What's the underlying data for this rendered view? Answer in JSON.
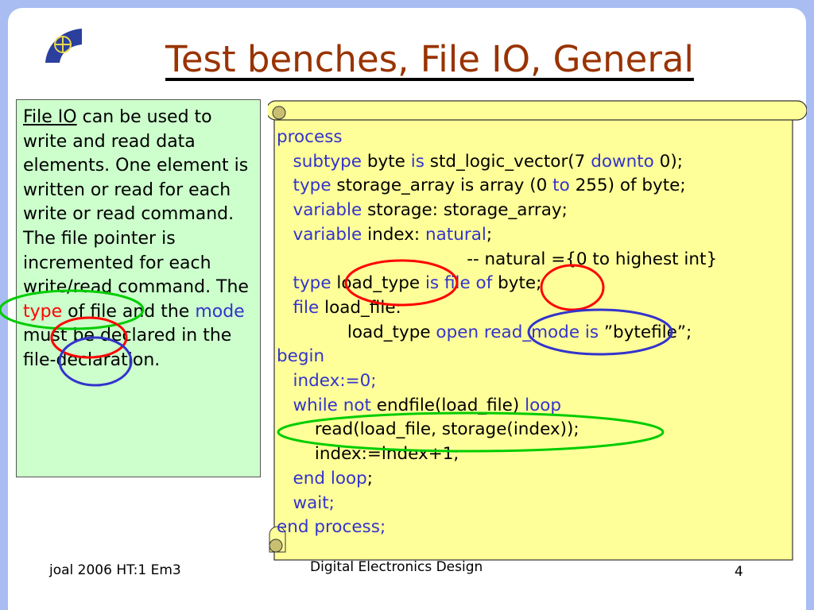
{
  "title": "Test benches, File IO, General",
  "note": {
    "link": "File IO",
    "p1": " can be used to write and read data elements. One element is written or read for each write or read command. The file pointer is incremented for each write/read command. The ",
    "type": "type",
    "p2": " of file and the ",
    "mode": "mode",
    "p3": " must be declared in the file-declaration."
  },
  "code": [
    [
      [
        "k",
        "process"
      ]
    ],
    [
      [
        "n",
        "   "
      ],
      [
        "k",
        "subtype"
      ],
      [
        "n",
        " byte "
      ],
      [
        "k",
        "is"
      ],
      [
        "n",
        " std_logic_vector(7 "
      ],
      [
        "k",
        "downto"
      ],
      [
        "n",
        " 0);"
      ]
    ],
    [
      [
        "n",
        "   "
      ],
      [
        "k",
        "type"
      ],
      [
        "n",
        " storage_array is array (0 "
      ],
      [
        "k",
        "to"
      ],
      [
        "n",
        " 255) of byte;"
      ]
    ],
    [
      [
        "n",
        "   "
      ],
      [
        "k",
        "variable"
      ],
      [
        "n",
        " storage: storage_array;"
      ]
    ],
    [
      [
        "n",
        "   "
      ],
      [
        "k",
        "variable"
      ],
      [
        "n",
        " index: "
      ],
      [
        "k",
        "natural"
      ],
      [
        "n",
        ";"
      ]
    ],
    [
      [
        "n",
        "                                   -- natural ={0 to highest int}"
      ]
    ],
    [
      [
        "n",
        "   "
      ],
      [
        "k",
        "type"
      ],
      [
        "n",
        " load_type "
      ],
      [
        "k",
        "is file of"
      ],
      [
        "n",
        " byte;"
      ]
    ],
    [
      [
        "n",
        "   "
      ],
      [
        "k",
        "file"
      ],
      [
        "n",
        " load_file:"
      ]
    ],
    [
      [
        "n",
        "             load_type "
      ],
      [
        "k",
        "open"
      ],
      [
        "n",
        " "
      ],
      [
        "k",
        "read_mode is"
      ],
      [
        "n",
        " ”bytefile”;"
      ]
    ],
    [
      [
        "k",
        "begin"
      ]
    ],
    [
      [
        "n",
        "   "
      ],
      [
        "k",
        "index:=0;"
      ]
    ],
    [
      [
        "n",
        "   "
      ],
      [
        "k",
        "while not"
      ],
      [
        "n",
        " endfile(load_file) "
      ],
      [
        "k",
        "loop"
      ]
    ],
    [
      [
        "n",
        "       read(load_file, storage(index));"
      ]
    ],
    [
      [
        "n",
        "       index:=index+1;"
      ]
    ],
    [
      [
        "n",
        "   "
      ],
      [
        "k",
        "end loop"
      ],
      [
        "n",
        ";"
      ]
    ],
    [
      [
        "n",
        "   "
      ],
      [
        "k",
        "wait;"
      ]
    ],
    [
      [
        "k",
        "end process;"
      ]
    ]
  ],
  "footer": {
    "left": "joal 2006 HT:1 Em3",
    "center": "Digital Electronics Design",
    "page": "4"
  }
}
